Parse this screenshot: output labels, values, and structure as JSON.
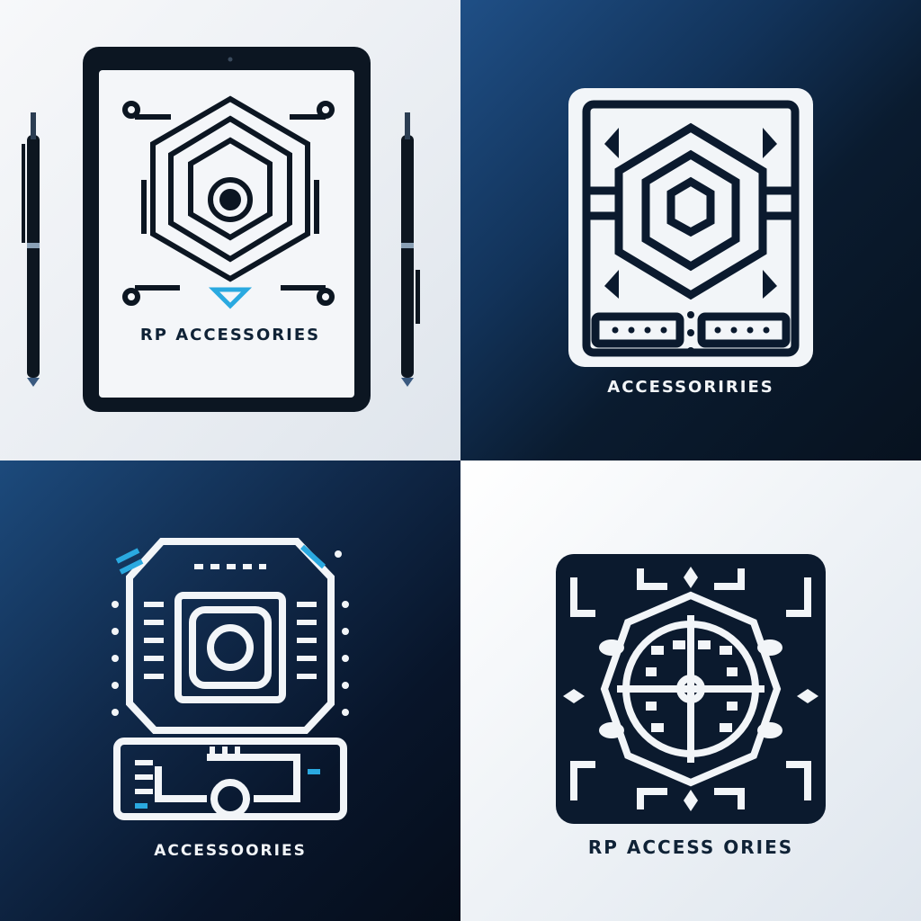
{
  "panels": [
    {
      "caption": "RP ACCESSORIES"
    },
    {
      "caption": "ACCESSORIRIES"
    },
    {
      "caption": "ACCESSOORIES"
    },
    {
      "caption": "RP ACCESS ORIES"
    }
  ],
  "colors": {
    "navy": "#0b1a2e",
    "white": "#f2f5f8",
    "accent_cyan": "#2aa9e0"
  },
  "icons": [
    "tablet-icon",
    "pen-icon",
    "hexagon-emblem-icon",
    "chip-emblem-icon",
    "compass-emblem-icon"
  ]
}
